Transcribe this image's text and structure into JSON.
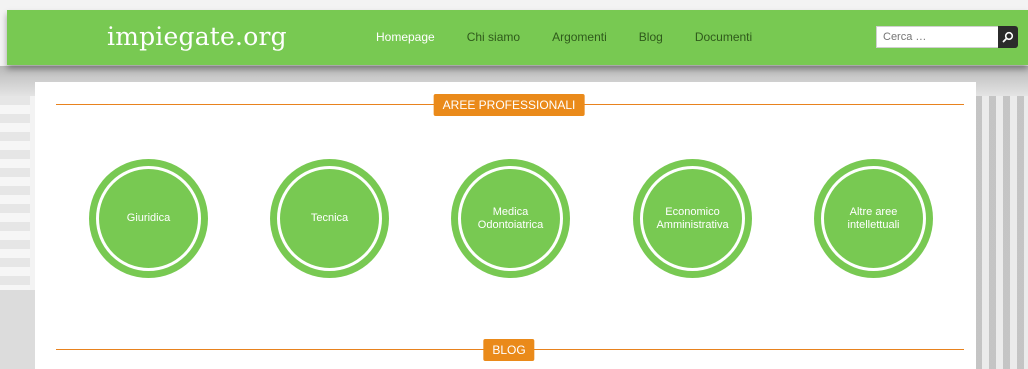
{
  "header": {
    "logo": "impiegate.org",
    "nav": [
      {
        "label": "Homepage",
        "active": true
      },
      {
        "label": "Chi siamo",
        "active": false
      },
      {
        "label": "Argomenti",
        "active": false
      },
      {
        "label": "Blog",
        "active": false
      },
      {
        "label": "Documenti",
        "active": false
      }
    ],
    "search": {
      "placeholder": "Cerca …",
      "icon": "search-icon"
    }
  },
  "sections": {
    "areas_title": "AREE PROFESSIONALI",
    "blog_title": "BLOG"
  },
  "areas": [
    {
      "label": "Giuridica"
    },
    {
      "label": "Tecnica"
    },
    {
      "label": "Medica Odontoiatrica"
    },
    {
      "label": "Economico Amministrativa"
    },
    {
      "label": "Altre aree intellettuali"
    }
  ],
  "colors": {
    "green": "#78c952",
    "orange": "#ea8a1a",
    "dark": "#2b2b2b"
  }
}
